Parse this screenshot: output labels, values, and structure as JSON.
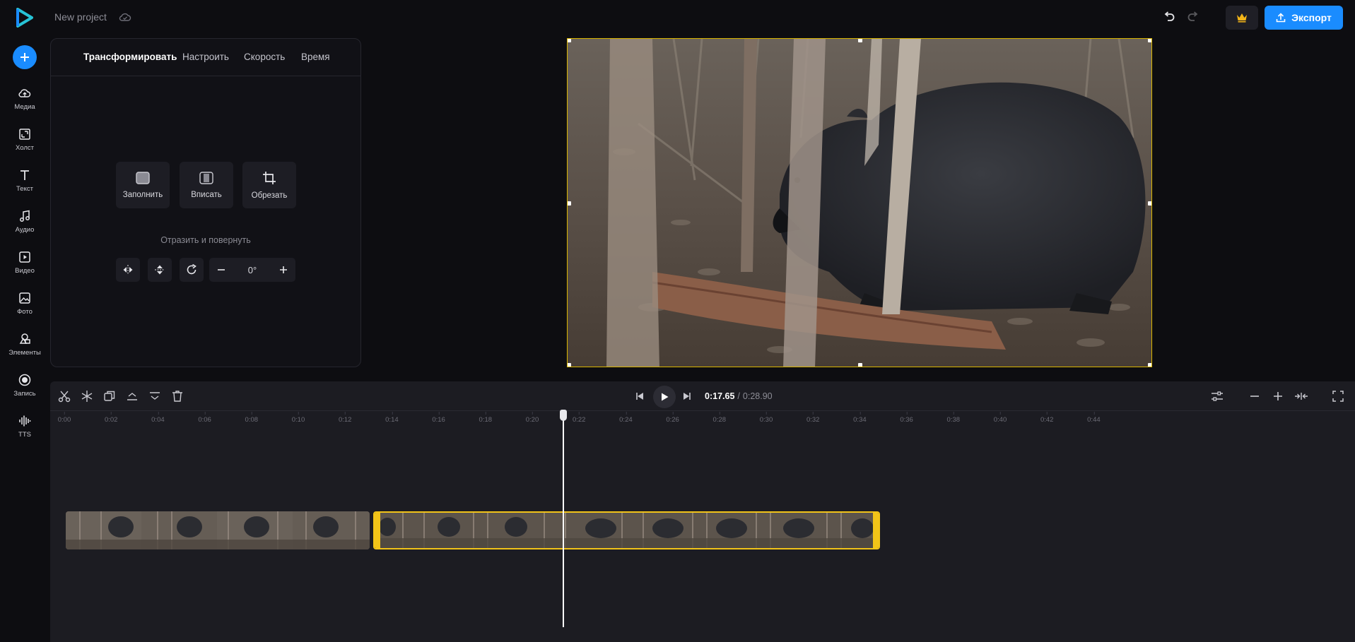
{
  "header": {
    "project_title": "New project",
    "export_label": "Экспорт"
  },
  "sidebar": {
    "items": [
      {
        "label": "Медиа",
        "icon": "upload-cloud-icon"
      },
      {
        "label": "Холст",
        "icon": "canvas-icon"
      },
      {
        "label": "Текст",
        "icon": "text-icon"
      },
      {
        "label": "Аудио",
        "icon": "music-note-icon"
      },
      {
        "label": "Видео",
        "icon": "video-icon"
      },
      {
        "label": "Фото",
        "icon": "photo-icon"
      },
      {
        "label": "Элементы",
        "icon": "shapes-icon"
      },
      {
        "label": "Запись",
        "icon": "record-icon"
      },
      {
        "label": "TTS",
        "icon": "waveform-icon"
      }
    ]
  },
  "panel": {
    "tabs": [
      "Трансформировать",
      "Настроить",
      "Скорость",
      "Время"
    ],
    "active_tab": "Трансформировать",
    "fill_label": "Заполнить",
    "fit_label": "Вписать",
    "crop_label": "Обрезать",
    "flip_rotate_label": "Отразить и повернуть",
    "rotation_value": "0°"
  },
  "timeline": {
    "current_time": "0:17.65",
    "separator": "/",
    "total_time": "0:28.90",
    "ticks": [
      "0:00",
      "0:02",
      "0:04",
      "0:06",
      "0:08",
      "0:10",
      "0:12",
      "0:14",
      "0:16",
      "0:18",
      "0:20",
      "0:22",
      "0:24",
      "0:26",
      "0:28",
      "0:30",
      "0:32",
      "0:34",
      "0:36",
      "0:38",
      "0:40",
      "0:42",
      "0:44"
    ]
  },
  "colors": {
    "accent": "#1a8cff",
    "selection": "#f2c418",
    "background": "#0d0d11",
    "timeline_bg": "#1c1c22"
  }
}
